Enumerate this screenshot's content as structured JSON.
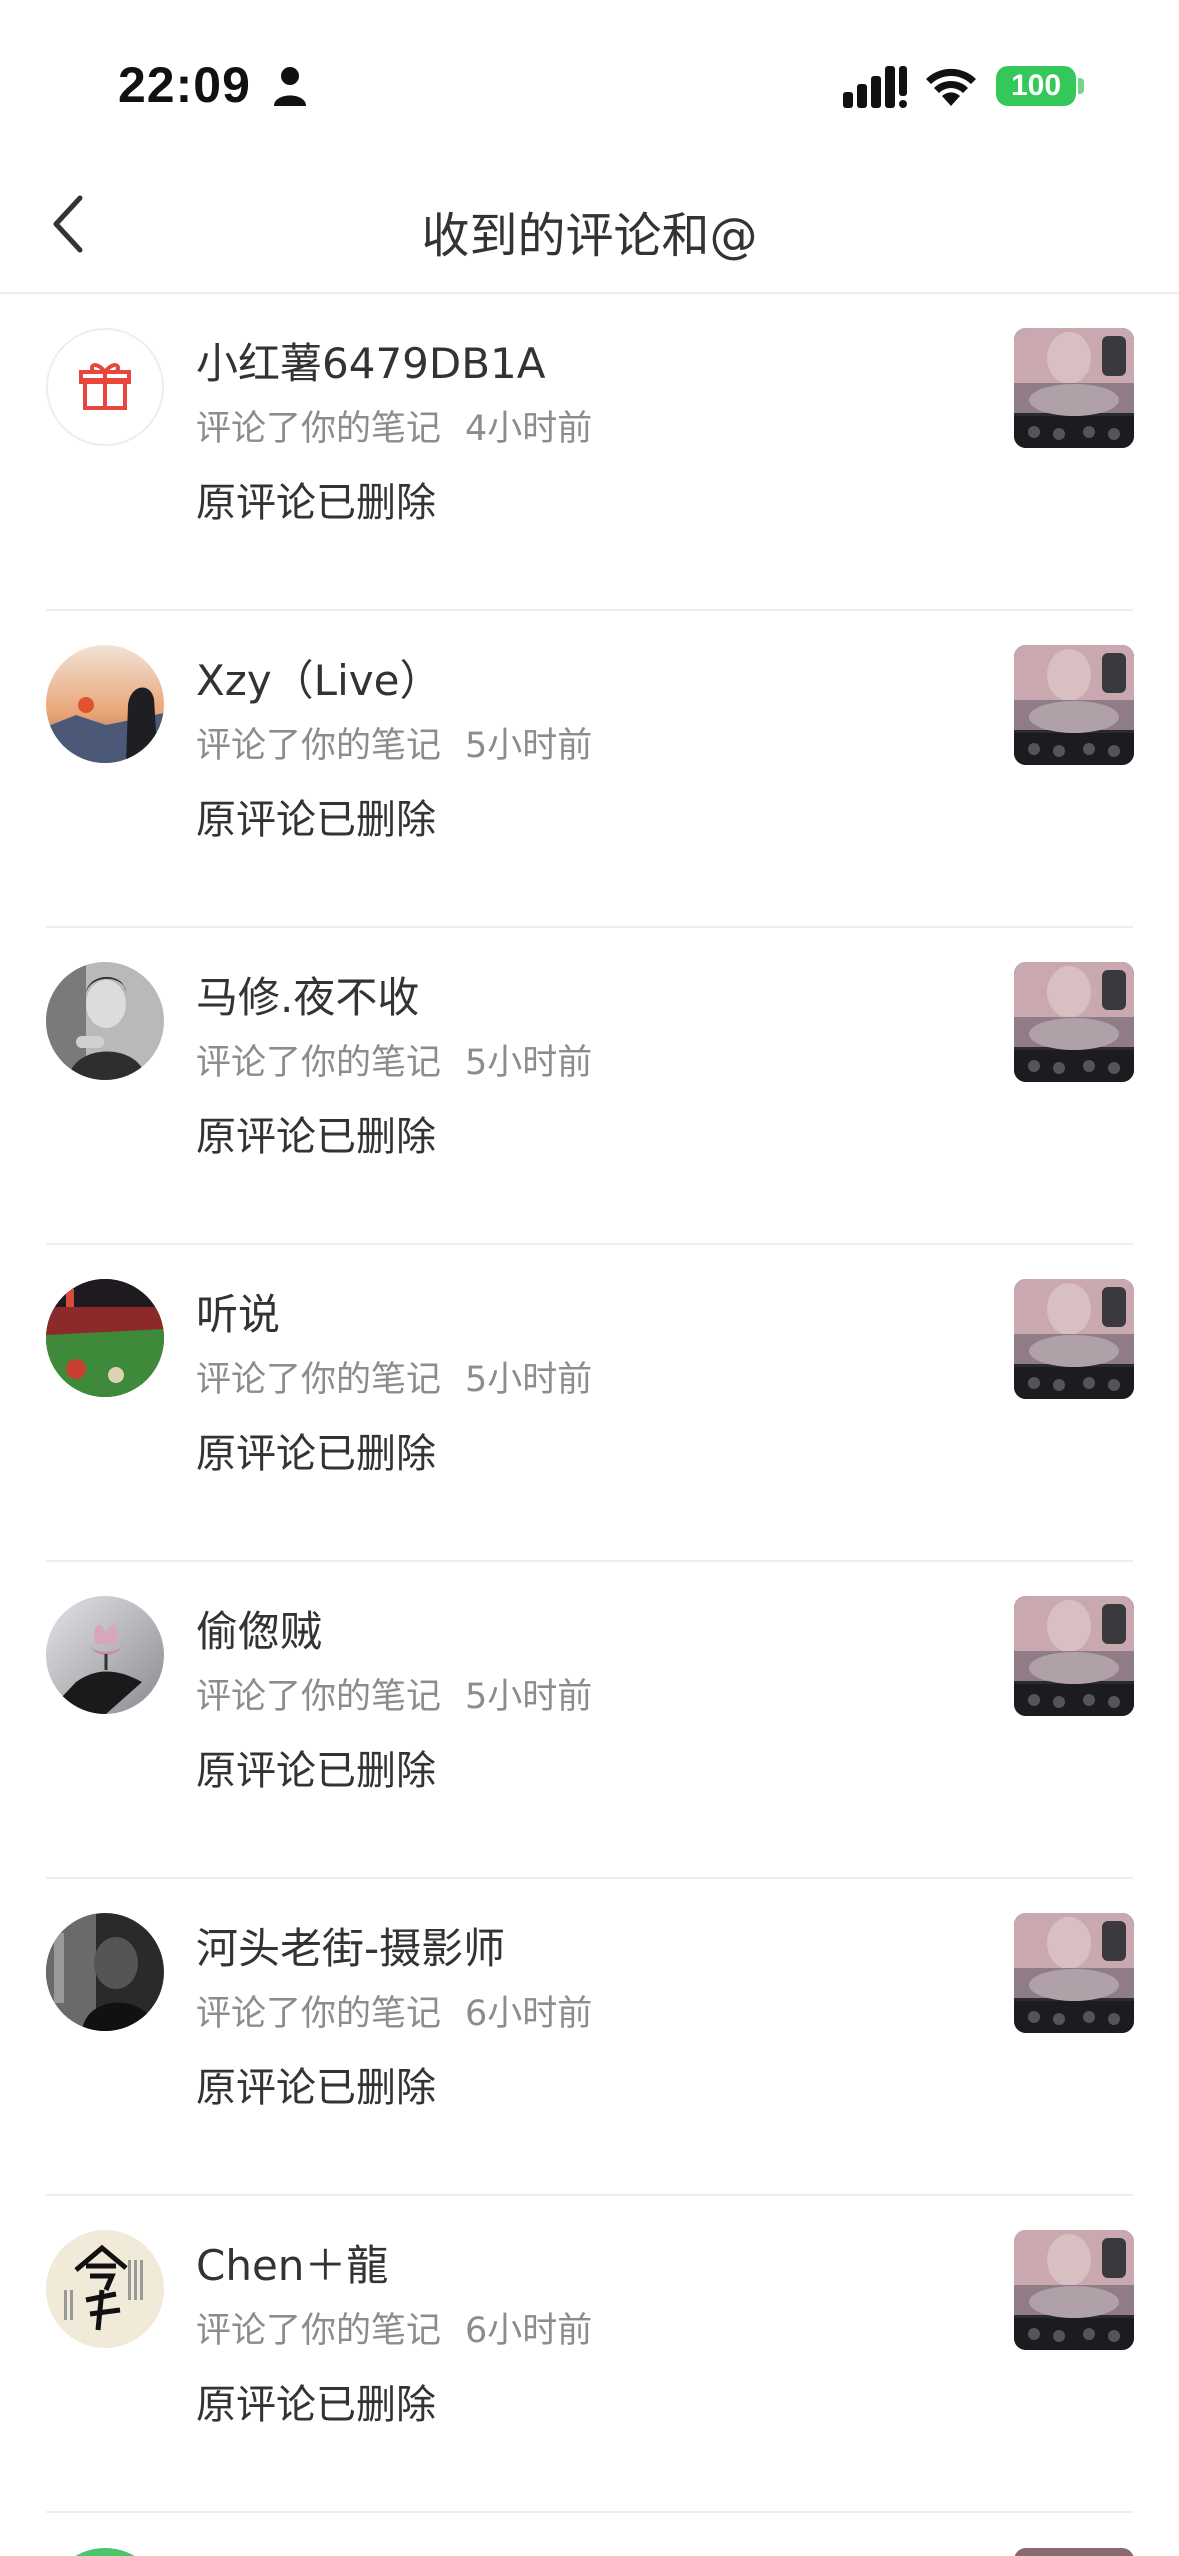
{
  "status_bar": {
    "time": "22:09",
    "battery": "100",
    "battery_color": "#34c759",
    "icons": [
      "person-icon",
      "signal-icon",
      "wifi-icon",
      "battery-icon"
    ]
  },
  "nav": {
    "title": "收到的评论和@",
    "back_icon": "chevron-left-icon"
  },
  "items": [
    {
      "username": "小红薯6479DB1A",
      "action": "评论了你的笔记",
      "time": "4小时前",
      "comment": "原评论已删除",
      "avatar": "gift-avatar"
    },
    {
      "username": "Xzy（Live）",
      "action": "评论了你的笔记",
      "time": "5小时前",
      "comment": "原评论已删除",
      "avatar": "sunset-avatar"
    },
    {
      "username": "马修.夜不收",
      "action": "评论了你的笔记",
      "time": "5小时前",
      "comment": "原评论已删除",
      "avatar": "bw-portrait-avatar"
    },
    {
      "username": "听说",
      "action": "评论了你的笔记",
      "time": "5小时前",
      "comment": "原评论已删除",
      "avatar": "stadium-avatar"
    },
    {
      "username": "偷偬贼",
      "action": "评论了你的笔记",
      "time": "5小时前",
      "comment": "原评论已删除",
      "avatar": "lotus-avatar"
    },
    {
      "username": "河头老街-摄影师",
      "action": "评论了你的笔记",
      "time": "6小时前",
      "comment": "原评论已删除",
      "avatar": "dark-photo-avatar"
    },
    {
      "username": "Chen＋龍",
      "action": "评论了你的笔记",
      "time": "6小时前",
      "comment": "原评论已删除",
      "avatar": "calligraphy-avatar"
    }
  ]
}
